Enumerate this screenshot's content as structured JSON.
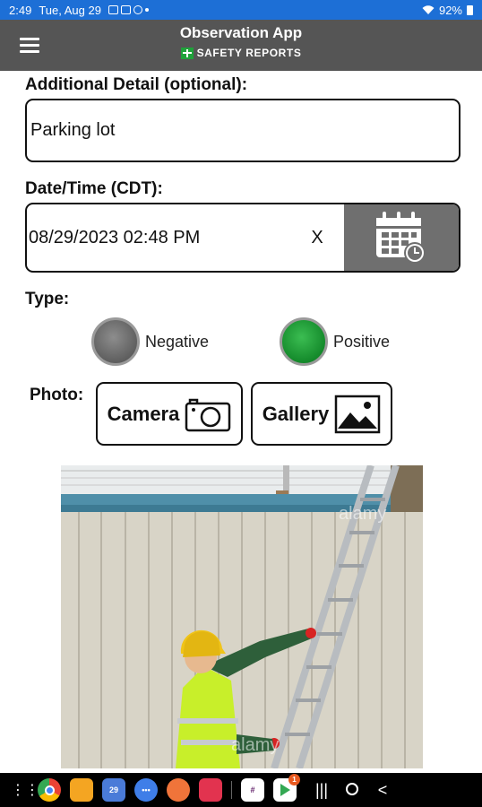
{
  "status_bar": {
    "time": "2:49",
    "date": "Tue, Aug 29",
    "battery": "92%"
  },
  "header": {
    "title": "Observation App",
    "brand": "SAFETY REPORTS"
  },
  "form": {
    "additional_detail_label": "Additional Detail (optional):",
    "additional_detail_value": "Parking lot",
    "datetime_label": "Date/Time (CDT):",
    "datetime_value": "08/29/2023 02:48 PM",
    "clear_label": "X",
    "type_label": "Type:",
    "type_options": [
      {
        "label": "Negative",
        "color": "#6a6a6a"
      },
      {
        "label": "Positive",
        "color": "#1a9a33"
      }
    ],
    "photo_label": "Photo:",
    "camera_label": "Camera",
    "gallery_label": "Gallery",
    "photo_watermark": "alamy"
  },
  "nav_bar": {
    "calendar_day": "29",
    "play_badge": "1",
    "apps": [
      "apps-grid-icon",
      "chrome-icon",
      "files-icon",
      "calendar-icon",
      "messages-icon",
      "contacts-icon",
      "camera-app-icon",
      "slack-icon",
      "play-store-icon"
    ]
  }
}
